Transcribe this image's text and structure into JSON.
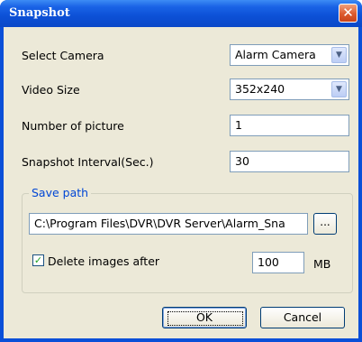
{
  "window": {
    "title": "Snapshot",
    "close_glyph": "✕"
  },
  "form": {
    "select_camera": {
      "label": "Select Camera",
      "value": "Alarm Camera"
    },
    "video_size": {
      "label": "Video Size",
      "value": "352x240"
    },
    "number_of_picture": {
      "label": "Number of picture",
      "value": "1"
    },
    "snapshot_interval": {
      "label": "Snapshot Interval(Sec.)",
      "value": "30"
    }
  },
  "save_path": {
    "group_label": "Save path",
    "path_value": "C:\\Program Files\\DVR\\DVR Server\\Alarm_Sna",
    "browse_label": "...",
    "delete_checkbox": {
      "label": "Delete images after",
      "checked": true
    },
    "size_value": "100",
    "size_unit": "MB"
  },
  "buttons": {
    "ok": "OK",
    "cancel": "Cancel"
  },
  "colors": {
    "titlebar": "#0a4fd8",
    "client": "#ece9d8",
    "group_title": "#0046d5",
    "close": "#dc5a2e"
  }
}
